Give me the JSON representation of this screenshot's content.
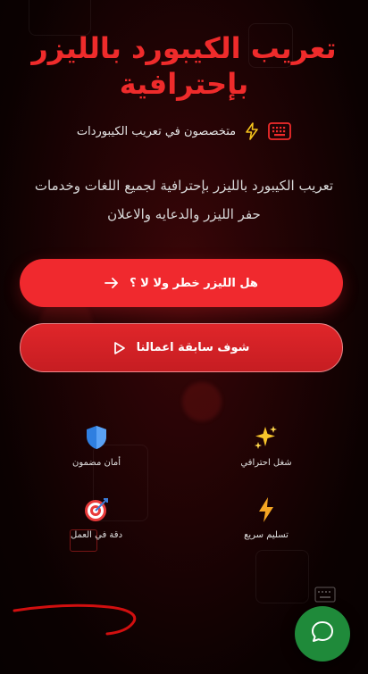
{
  "hero": {
    "title_line1": "تعريب الكيبورد بالليزر",
    "title_line2": "بإحترافية"
  },
  "tagline": {
    "text": "متخصصون في تعريب الكيبوردات",
    "icons": [
      "keyboard-icon",
      "lightning-icon"
    ]
  },
  "description": {
    "line1": "تعريب الكيبورد بالليزر بإحترافية لجميع اللغات وخدمات",
    "line2": "حفر الليزر والدعايه والاعلان"
  },
  "buttons": {
    "primary_label": "هل الليزر خطر ولا لا ؟",
    "secondary_label": "شوف سابقة اعمالنا"
  },
  "features": [
    {
      "label": "شغل احترافي",
      "icon": "sparkles-icon"
    },
    {
      "label": "أمان مضمون",
      "icon": "shield-icon"
    },
    {
      "label": "تسليم سريع",
      "icon": "lightning-icon"
    },
    {
      "label": "دقة في العمل",
      "icon": "target-icon"
    }
  ],
  "colors": {
    "accent": "#f0292e",
    "title_red": "#ef2b2b",
    "fab_green": "#1f8a3a"
  }
}
